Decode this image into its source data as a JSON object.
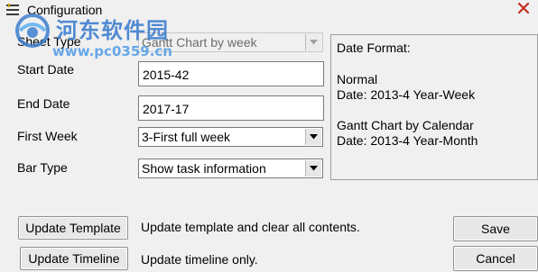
{
  "window": {
    "title": "Configuration"
  },
  "watermark": {
    "name": "河东软件园",
    "url": "www.pc0359.cn"
  },
  "form": {
    "sheet_type": {
      "label": "Sheet Type",
      "value": "Gantt Chart by week",
      "enabled": false
    },
    "start_date": {
      "label": "Start Date",
      "value": "2015-42"
    },
    "end_date": {
      "label": "End Date",
      "value": "2017-17"
    },
    "first_week": {
      "label": "First Week",
      "value": "3-First full week"
    },
    "bar_type": {
      "label": "Bar Type",
      "value": "Show task information"
    }
  },
  "info_panel": {
    "heading": "Date Format:",
    "normal_title": "Normal",
    "normal_format": "Date: 2013-4 Year-Week",
    "calendar_title": "Gantt Chart by Calendar",
    "calendar_format": "Date: 2013-4 Year-Month"
  },
  "actions": {
    "update_template": {
      "label": "Update Template",
      "description": "Update template and clear all contents."
    },
    "update_timeline": {
      "label": "Update Timeline",
      "description": "Update timeline only."
    },
    "save_label": "Save",
    "cancel_label": "Cancel"
  },
  "colors": {
    "window_bg": "#f0f0f0",
    "close_x": "#c42b1c",
    "watermark_blue": "#3f7fcf"
  }
}
